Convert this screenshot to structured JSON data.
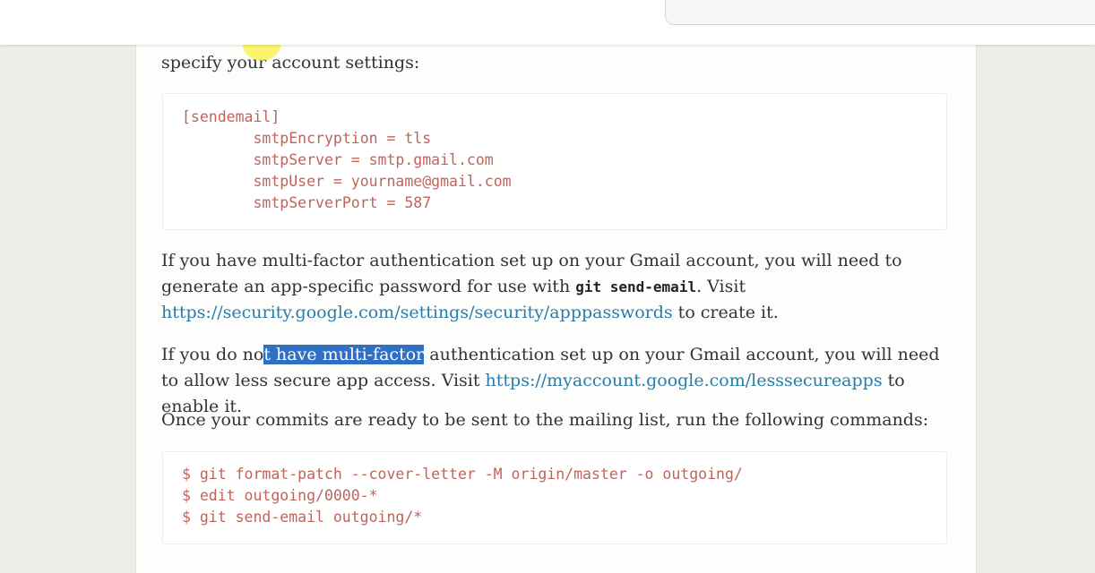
{
  "header": {
    "search_partial_text": "",
    "search_icon": "search-icon"
  },
  "article": {
    "intro_tail": "specify your account settings:",
    "config_block": "[sendemail]\n\tsmtpEncryption = tls\n\tsmtpServer = smtp.gmail.com\n\tsmtpUser = yourname@gmail.com\n\tsmtpServerPort = 587",
    "mfa_para": {
      "before_code": "If you have multi-factor authentication set up on your Gmail account, you will need to generate an app-specific password for use with ",
      "code": "git send-email",
      "after_code": ". Visit ",
      "link": "https://security.google.com/settings/security/apppasswords",
      "after_link": " to create it."
    },
    "no_mfa_para": {
      "before_sel": "If you do no",
      "selected": "t have multi-factor",
      "after_sel": " authentication set up on your Gmail account, you will need to allow less secure app access. Visit ",
      "link": "https://myaccount.google.com/lesssecureapps",
      "after_link": " to enable it."
    },
    "commands_intro": "Once your commits are ready to be sent to the mailing list, run the following commands:",
    "commands_block": "$ git format-patch --cover-letter -M origin/master -o outgoing/\n$ edit outgoing/0000-*\n$ git send-email outgoing/*"
  },
  "colors": {
    "link": "#2a7ba6",
    "code_text": "#c0645a",
    "selection": "#2f6fc4",
    "cursor_highlight": "#f8f032"
  }
}
